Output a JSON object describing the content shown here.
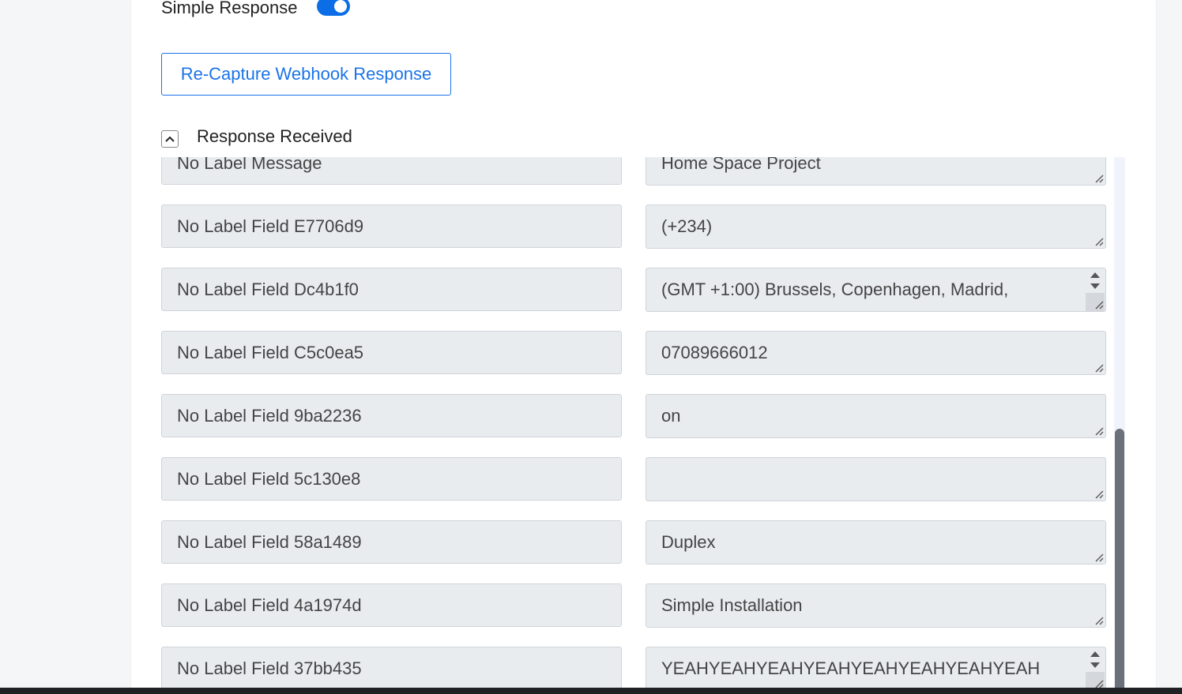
{
  "simple_response": {
    "label": "Simple Response",
    "enabled": true
  },
  "recapture_button": {
    "label": "Re-Capture Webhook Response"
  },
  "response_section": {
    "title": "Response Received",
    "collapse_icon": "chevron-up-icon"
  },
  "fields": [
    {
      "key": "No Label Message",
      "value": "Home Space Project",
      "spinner": false
    },
    {
      "key": "No Label Field E7706d9",
      "value": "(+234)",
      "spinner": false
    },
    {
      "key": "No Label Field Dc4b1f0",
      "value": "(GMT +1:00) Brussels, Copenhagen, Madrid,",
      "spinner": true
    },
    {
      "key": "No Label Field C5c0ea5",
      "value": "07089666012",
      "spinner": false
    },
    {
      "key": "No Label Field 9ba2236",
      "value": "on",
      "spinner": false
    },
    {
      "key": "No Label Field 5c130e8",
      "value": "",
      "spinner": false
    },
    {
      "key": "No Label Field 58a1489",
      "value": "Duplex",
      "spinner": false
    },
    {
      "key": "No Label Field 4a1974d",
      "value": "Simple Installation",
      "spinner": false
    },
    {
      "key": "No Label Field 37bb435",
      "value": "YEAHYEAHYEAHYEAHYEAHYEAHYEAHYEAH",
      "spinner": true
    }
  ],
  "colors": {
    "accent": "#1a73e8",
    "toggle_on": "#0b6ee6",
    "field_bg": "#e9ecef",
    "scroll_thumb": "#6b7079"
  }
}
